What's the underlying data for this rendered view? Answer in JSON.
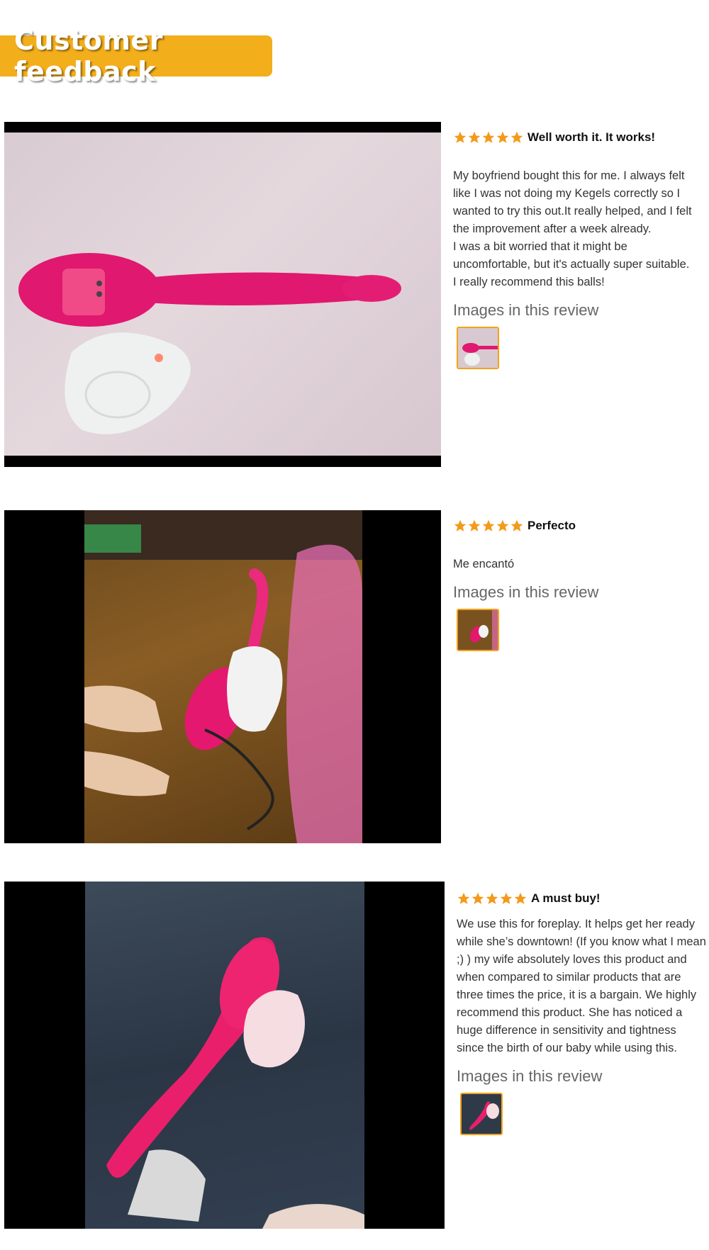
{
  "header": {
    "title": "Customer feedback"
  },
  "colors": {
    "banner": "#f3ae1b",
    "star": "#f39a1b",
    "thumb_border": "#f3a21b"
  },
  "reviews": [
    {
      "rating": 5,
      "title": "Well worth it. It works!",
      "body": [
        "My boyfriend bought this for me. I always felt like I was not doing my Kegels correctly so I wanted to try this out.It really helped, and I felt the improvement after a week already.",
        "I was a bit worried that it might be uncomfortable, but it's actually super suitable.",
        "I really recommend this balls!"
      ],
      "images_heading": "Images in this review",
      "photo_icon": "product-photo"
    },
    {
      "rating": 5,
      "title": "Perfecto",
      "body": [
        "Me encantó"
      ],
      "images_heading": "Images in this review",
      "photo_icon": "product-photo"
    },
    {
      "rating": 5,
      "title": "A must buy!",
      "body": [
        "We use this for foreplay. It helps get her ready while she’s downtown! (If you know what I mean ;) ) my wife absolutely loves this product and when compared to similar products that are three times the price, it is a bargain. We highly recommend this product. She has noticed a huge difference in sensitivity and tightness since the birth of our baby while using this."
      ],
      "images_heading": "Images in this review",
      "photo_icon": "product-photo"
    }
  ]
}
